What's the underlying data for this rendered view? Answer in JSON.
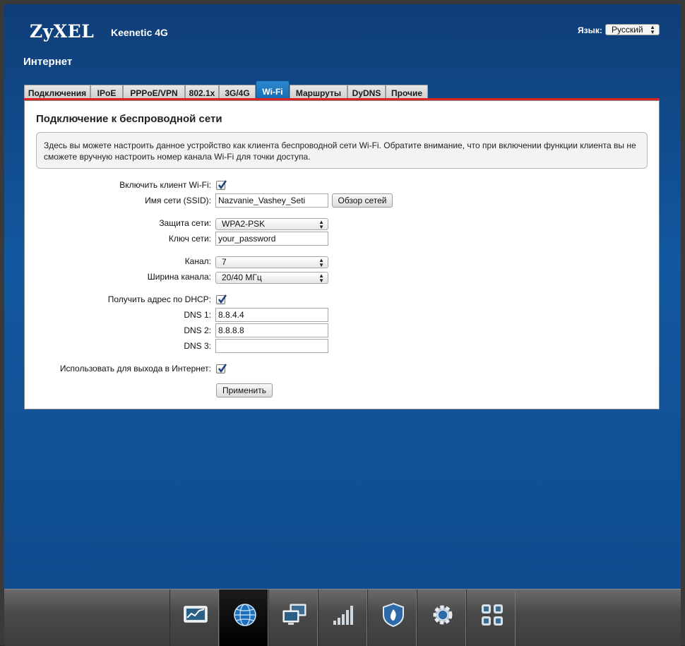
{
  "header": {
    "logo": "ZyXEL",
    "model": "Keenetic 4G",
    "language_label": "Язык:",
    "language_value": "Русский"
  },
  "page_title": "Интернет",
  "tabs": [
    {
      "label": "Подключения",
      "active": false
    },
    {
      "label": "IPoE",
      "active": false
    },
    {
      "label": "PPPoE/VPN",
      "active": false
    },
    {
      "label": "802.1x",
      "active": false
    },
    {
      "label": "3G/4G",
      "active": false
    },
    {
      "label": "Wi-Fi",
      "active": true
    },
    {
      "label": "Маршруты",
      "active": false
    },
    {
      "label": "DyDNS",
      "active": false
    },
    {
      "label": "Прочие",
      "active": false
    }
  ],
  "panel": {
    "title": "Подключение к беспроводной сети",
    "info": "Здесь вы можете настроить данное устройство как клиента беспроводной сети Wi-Fi. Обратите внимание, что при включении функции клиента вы не сможете вручную настроить номер канала Wi-Fi для точки доступа."
  },
  "form": {
    "enable_client": {
      "label": "Включить клиент Wi-Fi:",
      "checked": true
    },
    "ssid": {
      "label": "Имя сети (SSID):",
      "value": "Nazvanie_Vashey_Seti"
    },
    "scan_button": "Обзор сетей",
    "security": {
      "label": "Защита сети:",
      "value": "WPA2-PSK"
    },
    "key": {
      "label": "Ключ сети:",
      "value": "your_password"
    },
    "channel": {
      "label": "Канал:",
      "value": "7"
    },
    "width": {
      "label": "Ширина канала:",
      "value": "20/40 МГц"
    },
    "dhcp": {
      "label": "Получить адрес по DHCP:",
      "checked": true
    },
    "dns1": {
      "label": "DNS 1:",
      "value": "8.8.4.4"
    },
    "dns2": {
      "label": "DNS 2:",
      "value": "8.8.8.8"
    },
    "dns3": {
      "label": "DNS 3:",
      "value": ""
    },
    "use_internet": {
      "label": "Использовать для выхода в Интернет:",
      "checked": true
    },
    "apply_button": "Применить"
  },
  "dock": [
    {
      "icon": "monitor-chart-icon",
      "active": false
    },
    {
      "icon": "globe-icon",
      "active": true
    },
    {
      "icon": "computers-icon",
      "active": false
    },
    {
      "icon": "signal-bars-icon",
      "active": false
    },
    {
      "icon": "shield-icon",
      "active": false
    },
    {
      "icon": "gear-icon",
      "active": false
    },
    {
      "icon": "apps-grid-icon",
      "active": false
    }
  ],
  "colors": {
    "accent": "#1467ad",
    "tab_underline": "#dd2222",
    "background": "#1257a0"
  }
}
